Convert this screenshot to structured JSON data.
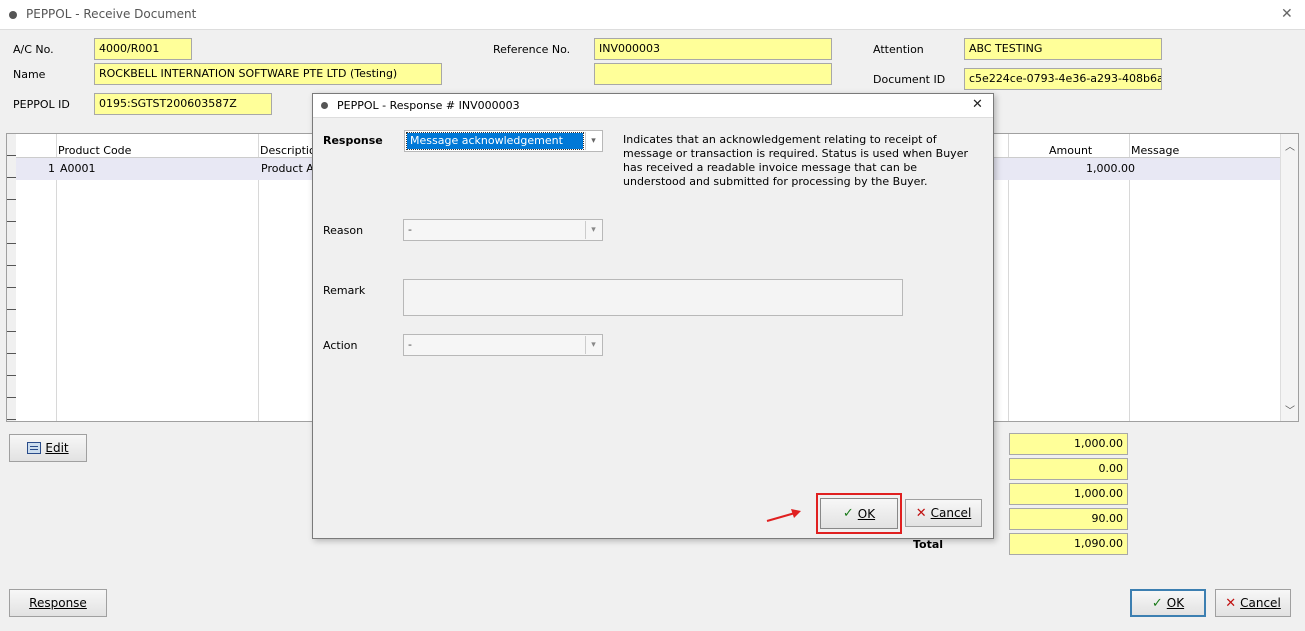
{
  "window": {
    "title": "PEPPOL - Receive Document",
    "close_glyph": "✕"
  },
  "header": {
    "ac_no_label": "A/C No.",
    "ac_no": "4000/R001",
    "name_label": "Name",
    "name": "ROCKBELL INTERNATION SOFTWARE PTE LTD (Testing)",
    "peppol_id_label": "PEPPOL ID",
    "peppol_id": "0195:SGTST200603587Z",
    "reference_label": "Reference No.",
    "reference_no": "INV000003",
    "reference_extra": "",
    "attention_label": "Attention",
    "attention": "ABC TESTING",
    "document_id_label": "Document ID",
    "document_id": "c5e224ce-0793-4e36-a293-408b6a"
  },
  "grid": {
    "columns": {
      "product_code": "Product Code",
      "description": "Descriptio",
      "amount": "Amount",
      "message": "Message"
    },
    "rows": [
      {
        "no": "1",
        "product_code": "A0001",
        "description": "Product A",
        "amount": "1,000.00",
        "message": ""
      }
    ]
  },
  "edit_button": {
    "label": "Edit"
  },
  "totals": {
    "values": [
      "1,000.00",
      "0.00",
      "1,000.00",
      "90.00",
      "1,090.00"
    ],
    "total_label": "Total"
  },
  "response_button": {
    "label": "Response"
  },
  "main_ok": {
    "label": "OK"
  },
  "main_cancel": {
    "label": "Cancel"
  },
  "dialog": {
    "title": "PEPPOL - Response # INV000003",
    "close_glyph": "✕",
    "response_label": "Response",
    "response_value": "Message acknowledgement",
    "description": "Indicates that an acknowledgement relating to receipt of message or transaction is required. Status is used when Buyer has received a readable invoice message that can be understood and submitted for processing by the Buyer.",
    "reason_label": "Reason",
    "reason_value": "-",
    "remark_label": "Remark",
    "remark_value": "",
    "action_label": "Action",
    "action_value": "-",
    "ok_label": "OK",
    "cancel_label": "Cancel"
  },
  "colors": {
    "highlight_field": "#ffff99",
    "selection": "#0078d7",
    "annotation_red": "#e02020"
  }
}
